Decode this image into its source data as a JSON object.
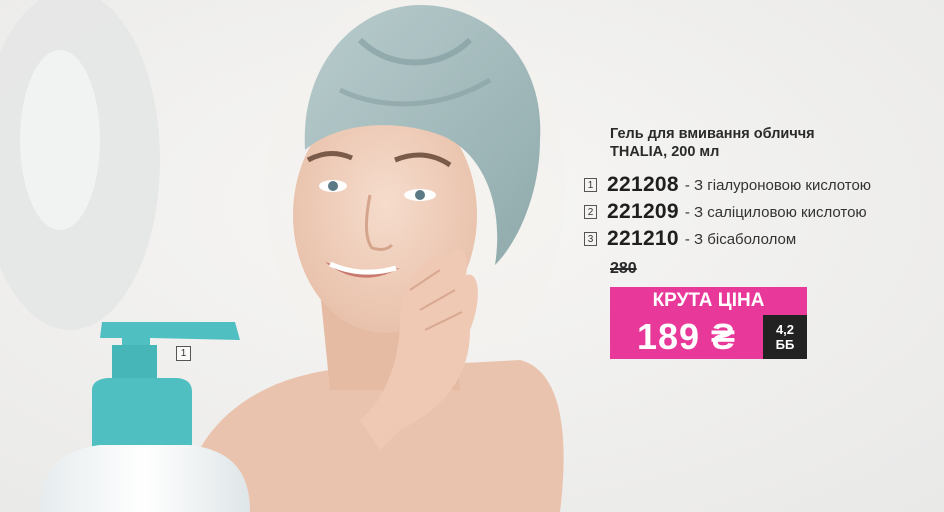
{
  "product": {
    "title_line1": "Гель для вмивання обличчя",
    "title_line2": "THALIA, 200 мл"
  },
  "variants": [
    {
      "num": "1",
      "code": "221208",
      "desc": "- З гіалуроновою кислотою"
    },
    {
      "num": "2",
      "code": "221209",
      "desc": "- З саліциловою кислотою"
    },
    {
      "num": "3",
      "code": "221210",
      "desc": "-  З бісабололом"
    }
  ],
  "price": {
    "old": "280",
    "promo_label": "КРУТА ЦІНА",
    "new": "189 ₴",
    "bb_line1": "4,2",
    "bb_line2": "ББ"
  },
  "bottle_tag": "1",
  "colors": {
    "accent": "#e8389a",
    "bb_badge": "#222222",
    "bottle_cap": "#4fbfc1"
  }
}
